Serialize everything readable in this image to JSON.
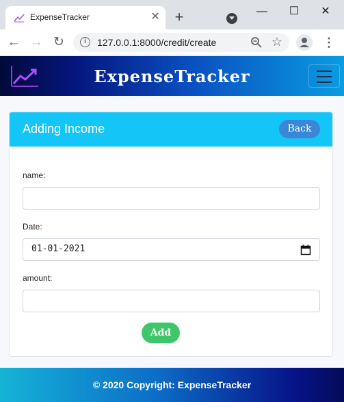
{
  "browser": {
    "tab_title": "ExpenseTracker",
    "tab_close": "✕",
    "new_tab": "+",
    "url": "127.0.0.1:8000/credit/create",
    "window_controls": [
      "—",
      "☐",
      "✕"
    ],
    "icons": [
      "favicon-chart-icon",
      "info-icon",
      "zoom-icon",
      "star-icon",
      "profile-avatar-icon",
      "menu-dots-icon"
    ]
  },
  "navbar": {
    "brand": "ExpenseTracker",
    "logo_icon": "trend-chart-icon",
    "menu_icon": "hamburger-icon"
  },
  "card": {
    "title": "Adding Income",
    "back_label": "Back",
    "fields": {
      "name_label": "name:",
      "name_value": "",
      "date_label": "Date:",
      "date_value": "01-01-2021",
      "amount_label": "amount:",
      "amount_value": ""
    },
    "submit_label": "Add"
  },
  "footer": {
    "text": "© 2020 Copyright: ExpenseTracker"
  },
  "colors": {
    "card_header": "#14c6f8",
    "back_button": "#3a87d8",
    "add_button": "#3ec76a",
    "navbar_dark": "#05167e",
    "footer_dark": "#07148a"
  }
}
